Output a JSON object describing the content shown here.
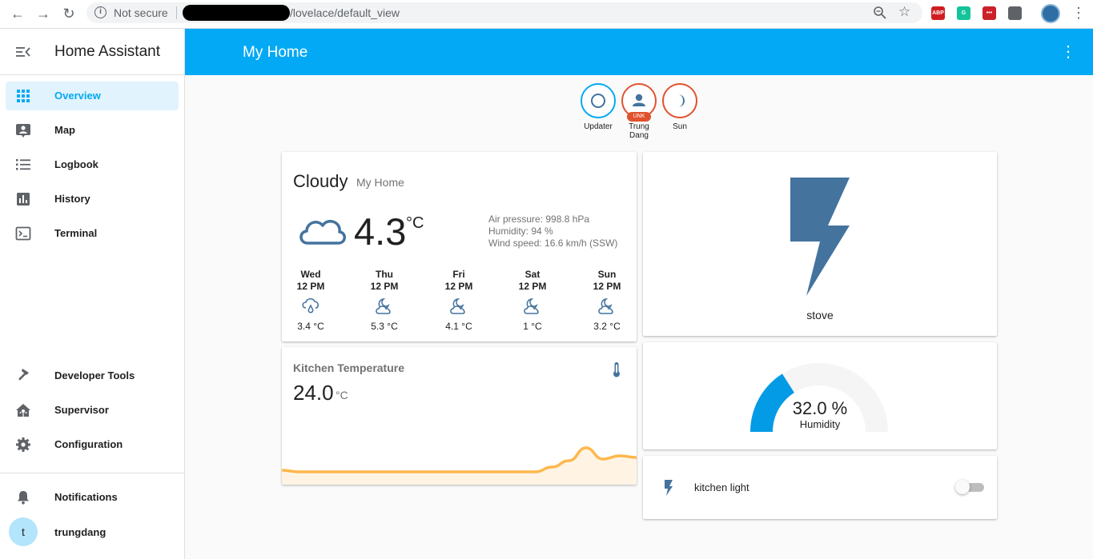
{
  "browser": {
    "security_label": "Not secure",
    "url": "/lovelace/default_view",
    "extensions": [
      {
        "name": "adblock-plus-icon",
        "label": "ABP",
        "color": "#d01d23"
      },
      {
        "name": "grammarly-icon",
        "label": "G",
        "color": "#15c39a"
      },
      {
        "name": "lastpass-icon",
        "label": "•••",
        "color": "#cc2029"
      },
      {
        "name": "extension-icon",
        "label": "",
        "color": "#5f6368"
      }
    ]
  },
  "sidebar": {
    "title": "Home Assistant",
    "items": [
      {
        "label": "Overview",
        "icon": "grid-icon",
        "active": true
      },
      {
        "label": "Map",
        "icon": "map-account-icon"
      },
      {
        "label": "Logbook",
        "icon": "list-icon"
      },
      {
        "label": "History",
        "icon": "chart-bar-icon"
      },
      {
        "label": "Terminal",
        "icon": "console-icon"
      }
    ],
    "bottom_items": [
      {
        "label": "Developer Tools",
        "icon": "hammer-icon"
      },
      {
        "label": "Supervisor",
        "icon": "home-assistant-icon"
      },
      {
        "label": "Configuration",
        "icon": "cog-icon"
      }
    ],
    "notifications_label": "Notifications",
    "user": {
      "initial": "t",
      "name": "trungdang"
    }
  },
  "header": {
    "title": "My Home"
  },
  "badges": [
    {
      "label": "Updater",
      "icon": "circle-outline-icon"
    },
    {
      "label": "Trung Dang",
      "icon": "account-icon",
      "tag": "UNK"
    },
    {
      "label": "Sun",
      "icon": "moon-icon"
    }
  ],
  "weather": {
    "condition": "Cloudy",
    "name": "My Home",
    "temperature": "4.3",
    "unit": "°C",
    "attributes": [
      "Air pressure: 998.8 hPa",
      "Humidity: 94 %",
      "Wind speed: 16.6 km/h (SSW)"
    ],
    "forecast": [
      {
        "day": "Wed",
        "time": "12 PM",
        "icon": "rainy-icon",
        "temp": "3.4 °C"
      },
      {
        "day": "Thu",
        "time": "12 PM",
        "icon": "partly-cloudy-night-icon",
        "temp": "5.3 °C"
      },
      {
        "day": "Fri",
        "time": "12 PM",
        "icon": "partly-cloudy-night-icon",
        "temp": "4.1 °C"
      },
      {
        "day": "Sat",
        "time": "12 PM",
        "icon": "partly-cloudy-night-icon",
        "temp": "1 °C"
      },
      {
        "day": "Sun",
        "time": "12 PM",
        "icon": "partly-cloudy-night-icon",
        "temp": "3.2 °C"
      }
    ]
  },
  "stove": {
    "label": "stove",
    "icon": "flash-icon",
    "color": "#44739e"
  },
  "kitchen_temperature": {
    "name": "Kitchen Temperature",
    "value": "24.0",
    "unit": "°C",
    "icon": "thermometer-icon",
    "graph_color": "#ffb74d",
    "history": [
      23.92,
      23.9,
      23.9,
      23.9,
      23.9,
      23.9,
      23.9,
      23.9,
      23.9,
      23.9,
      23.9,
      23.9,
      23.9,
      23.9,
      23.9,
      23.9,
      23.96,
      24.04,
      24.2,
      24.06,
      24.1,
      24.08
    ]
  },
  "humidity": {
    "value": "32.0 %",
    "fraction": 0.32,
    "label": "Humidity",
    "color": "#039be5"
  },
  "kitchen_light": {
    "name": "kitchen light",
    "icon": "flash-icon",
    "state": "off"
  }
}
